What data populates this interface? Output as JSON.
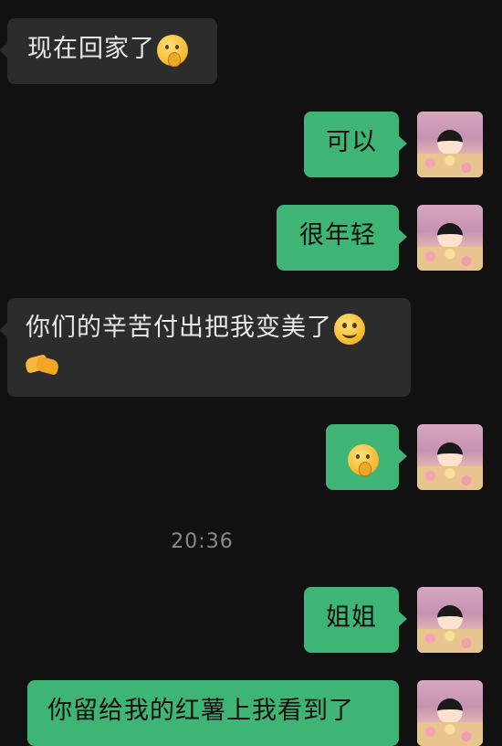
{
  "messages": [
    {
      "text": "现在回家了",
      "emoji": "thinking-face"
    },
    {
      "text": "可以"
    },
    {
      "text": "很年轻"
    },
    {
      "text": "你们的辛苦付出把我变美了",
      "emoji": "smiling-face",
      "emoji2": "handshake"
    },
    {
      "text": "",
      "emoji": "thinking-face"
    },
    {
      "text": "姐姐"
    },
    {
      "text": "你留给我的红薯上我看到了"
    }
  ],
  "timestamp": "20:36",
  "colors": {
    "background": "#111111",
    "incoming_bubble": "#2c2c2c",
    "outgoing_bubble": "#3eb575",
    "timestamp_text": "#8a8a8a"
  }
}
